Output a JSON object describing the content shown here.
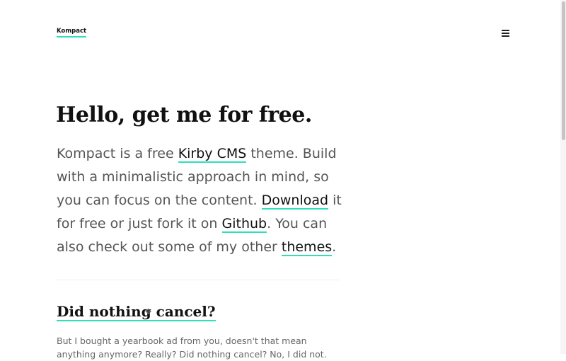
{
  "header": {
    "logo": "Kompact",
    "menu_icon": "hamburger-menu-icon"
  },
  "hero": {
    "title": "Hello, get me for free.",
    "text_1": "Kompact is a free ",
    "link_kirby": "Kirby CMS",
    "text_2": " theme. Build with a minimalistic approach in mind, so you can focus on the content. ",
    "link_download": "Download",
    "text_3": " it for free or just fork it on ",
    "link_github": "Github",
    "text_4": ". You can also check out some of my other ",
    "link_themes": "themes",
    "text_5": "."
  },
  "post": {
    "title": "Did nothing cancel?",
    "excerpt": "But I bought a yearbook ad from you, doesn't that mean anything anymore? Really? Did nothing cancel? No, I did not."
  },
  "colors": {
    "accent": "#2ee0b8",
    "text_dark": "#111111",
    "text_muted": "#555555"
  }
}
